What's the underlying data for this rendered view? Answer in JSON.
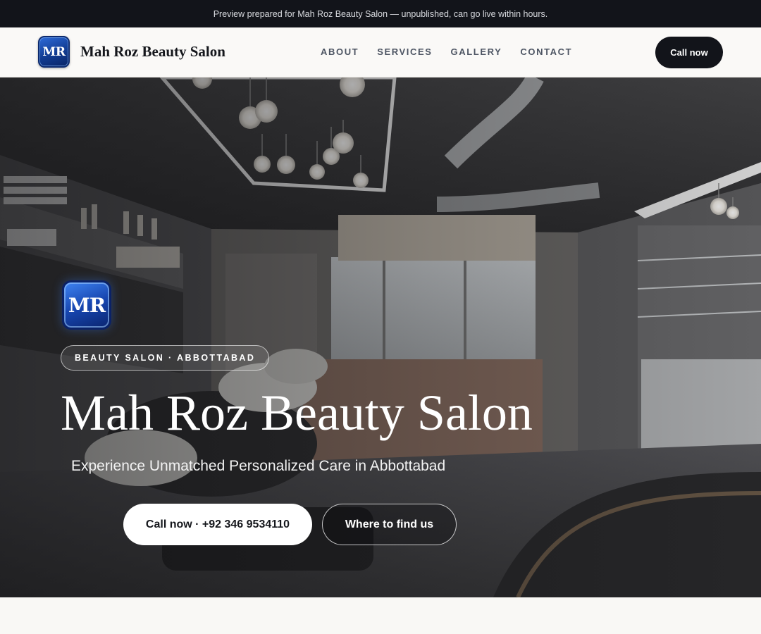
{
  "preview_bar": {
    "text": "Preview prepared for Mah Roz Beauty Salon — unpublished, can go live within hours."
  },
  "header": {
    "logo_text": "MR",
    "brand_name": "Mah Roz Beauty Salon",
    "nav": [
      {
        "label": "ABOUT"
      },
      {
        "label": "SERVICES"
      },
      {
        "label": "GALLERY"
      },
      {
        "label": "CONTACT"
      }
    ],
    "cta_label": "Call now"
  },
  "hero": {
    "logo_text": "MR",
    "badge": "BEAUTY SALON · ABBOTTABAD",
    "title": "Mah Roz Beauty Salon",
    "subtitle": "Experience Unmatched Personalized Care in Abbottabad",
    "primary_button": "Call now · +92 346 9534110",
    "secondary_button": "Where to find us"
  },
  "colors": {
    "dark": "#12141a",
    "page_background": "#f9f8f5",
    "logo_blue": "#1746b0",
    "white": "#ffffff"
  }
}
